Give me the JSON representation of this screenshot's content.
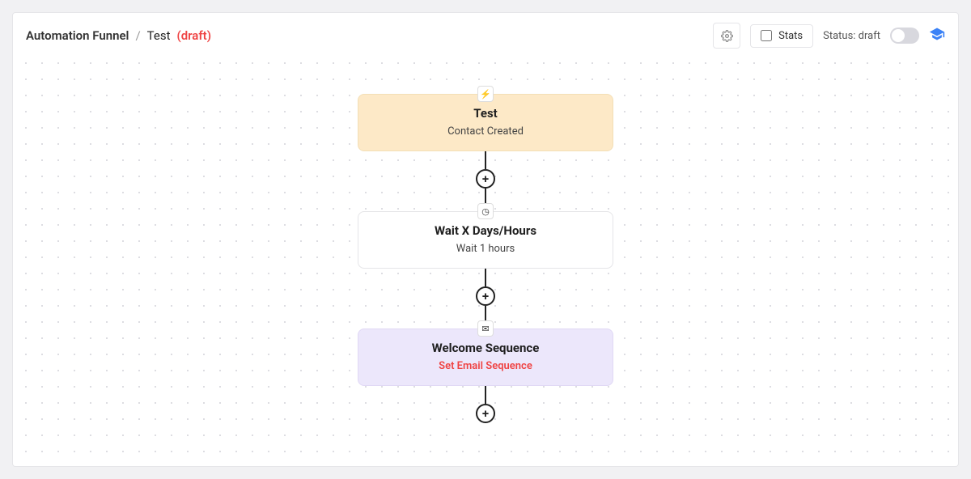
{
  "breadcrumb": {
    "root": "Automation Funnel",
    "sep": "/",
    "name": "Test",
    "draft": "(draft)"
  },
  "header": {
    "stats_label": "Stats",
    "status_label": "Status: draft"
  },
  "nodes": {
    "trigger": {
      "icon": "⚡",
      "title": "Test",
      "subtitle": "Contact Created"
    },
    "wait": {
      "icon": "◷",
      "title": "Wait X Days/Hours",
      "subtitle": "Wait 1 hours"
    },
    "action": {
      "icon": "✉",
      "title": "Welcome Sequence",
      "subtitle": "Set Email Sequence"
    }
  },
  "add_label": "+"
}
